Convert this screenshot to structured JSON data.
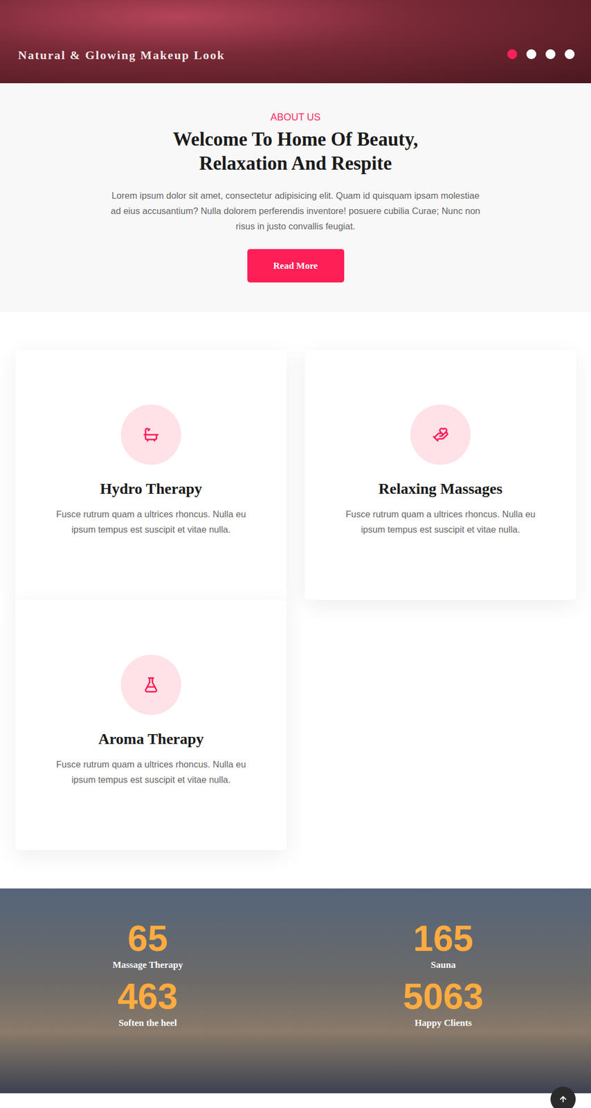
{
  "hero": {
    "title": "Natural & Glowing Makeup Look",
    "dots": [
      {
        "selected": true
      },
      {
        "selected": false
      },
      {
        "selected": false
      },
      {
        "selected": false
      }
    ]
  },
  "about": {
    "label": "ABOUT US",
    "heading_lines": [
      "Welcome To Home Of Beauty,",
      "Relaxation And Respite"
    ],
    "text": "Lorem ipsum dolor sit amet, consectetur adipisicing elit. Quam id quisquam ipsam molestiae ad eius accusantium? Nulla dolorem perferendis inventore! posuere cubilia Curae; Nunc non risus in justo convallis feugiat.",
    "button": "Read More"
  },
  "services": [
    {
      "title": "Hydro Therapy",
      "text": "Fusce rutrum quam a ultrices rhoncus. Nulla eu ipsum tempus est suscipit et vitae nulla."
    },
    {
      "title": "Relaxing Massages",
      "text": "Fusce rutrum quam a ultrices rhoncus. Nulla eu ipsum tempus est suscipit et vitae nulla."
    },
    {
      "title": "Aroma Therapy",
      "text": "Fusce rutrum quam a ultrices rhoncus. Nulla eu ipsum tempus est suscipit et vitae nulla."
    }
  ],
  "counters": [
    {
      "value": "65",
      "label": "Massage Therapy"
    },
    {
      "value": "165",
      "label": "Sauna"
    },
    {
      "value": "463",
      "label": "Soften the heel"
    },
    {
      "value": "5063",
      "label": "Happy Clients"
    }
  ]
}
